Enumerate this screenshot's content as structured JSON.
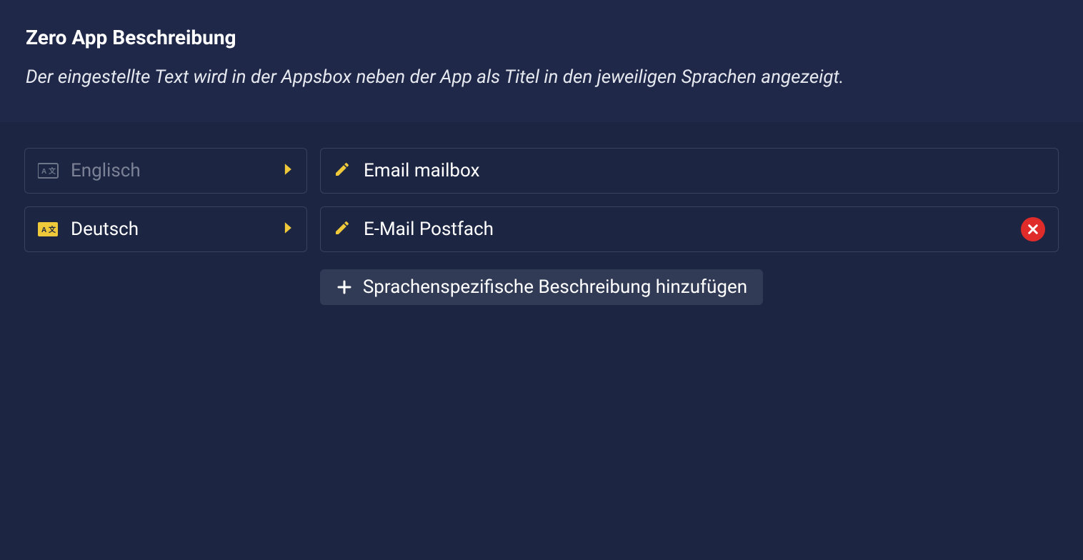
{
  "header": {
    "title": "Zero App Beschreibung",
    "description": "Der eingestellte Text wird in der Appsbox neben der App als Titel in den jeweiligen Sprachen angezeigt."
  },
  "rows": [
    {
      "language": "Englisch",
      "value": "Email mailbox",
      "active": false,
      "deletable": false
    },
    {
      "language": "Deutsch",
      "value": "E-Mail Postfach",
      "active": true,
      "deletable": true
    }
  ],
  "add_button_label": "Sprachenspezifische Beschreibung hinzufügen"
}
